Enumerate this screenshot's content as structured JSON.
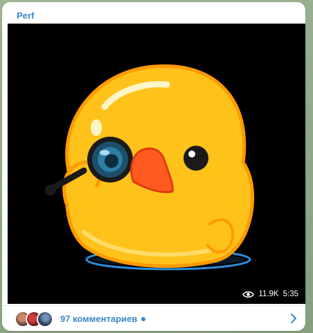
{
  "post": {
    "channel_name": "Perf",
    "media": {
      "icon": "duck-with-monocle-sticker",
      "views": "11.9K",
      "time": "5:35"
    },
    "comments": {
      "label": "97 комментариев",
      "accent_color": "#3a88c8"
    }
  }
}
